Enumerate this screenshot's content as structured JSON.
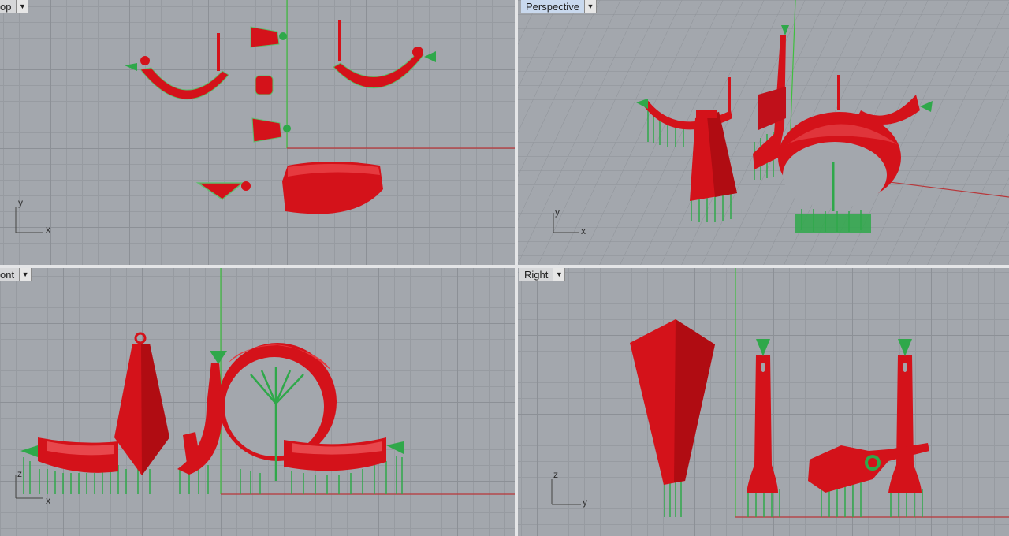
{
  "viewports": {
    "top": {
      "title": "Top",
      "visible_title": "op",
      "axis_x": "x",
      "axis_y": "y"
    },
    "perspective": {
      "title": "Perspective",
      "axis_x": "x",
      "axis_y": "y"
    },
    "front": {
      "title": "Front",
      "visible_title": "ont",
      "axis_x": "x",
      "axis_y": "z"
    },
    "right": {
      "title": "Right",
      "axis_x": "y",
      "axis_y": "z"
    }
  },
  "dropdown_icon": "chevron-down-icon",
  "colors": {
    "model": "#d4121a",
    "support": "#2fa84a",
    "x_axis": "#b8373a",
    "y_axis": "#3fbf3f",
    "active_title": "#c9d9ee"
  }
}
